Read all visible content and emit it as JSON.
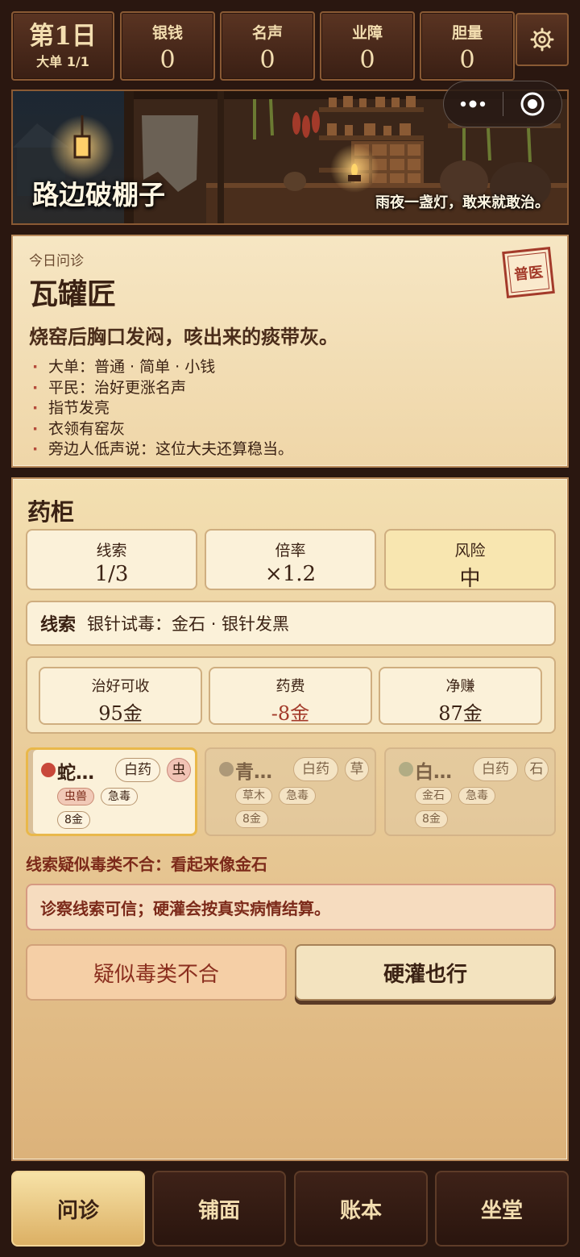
{
  "top_bar": {
    "day": {
      "label": "第1日",
      "sub": "大单 1/1"
    },
    "stats": [
      {
        "label": "银钱",
        "value": "0"
      },
      {
        "label": "名声",
        "value": "0"
      },
      {
        "label": "业障",
        "value": "0"
      },
      {
        "label": "胆量",
        "value": "0"
      }
    ],
    "settings_icon": "gear-icon"
  },
  "capsule": {
    "more_icon": "more-dots-icon",
    "close_icon": "target-close-icon"
  },
  "scene": {
    "title": "路边破棚子",
    "subtitle": "雨夜一盏灯，敢来就敢治。"
  },
  "patient": {
    "today_label": "今日问诊",
    "name": "瓦罐匠",
    "complaint": "烧窑后胸口发闷，咳出来的痰带灰。",
    "traits": [
      "大单：普通 · 简单 · 小钱",
      "平民：治好更涨名声",
      "指节发亮",
      "衣领有窑灰",
      "旁边人低声说：这位大夫还算稳当。"
    ],
    "stamp": "普医"
  },
  "cabinet": {
    "title": "药柜",
    "stats": [
      {
        "label": "线索",
        "value": "1/3"
      },
      {
        "label": "倍率",
        "value": "×1.2"
      },
      {
        "label": "风险",
        "value": "中"
      }
    ],
    "clue": {
      "label": "线索",
      "text": "银针试毒：金石 · 银针发黑"
    },
    "money": [
      {
        "label": "治好可收",
        "value": "95金"
      },
      {
        "label": "药费",
        "value": "-8金"
      },
      {
        "label": "净赚",
        "value": "87金"
      }
    ],
    "herbs": [
      {
        "name": "蛇…",
        "dot_color": "#c8483a",
        "type": "白药",
        "category": "虫",
        "tags": [
          "虫兽",
          "急毒"
        ],
        "cost": "8金",
        "selected": true
      },
      {
        "name": "青…",
        "dot_color": "#8a7a64",
        "type": "白药",
        "category": "草",
        "tags": [
          "草木",
          "急毒"
        ],
        "cost": "8金",
        "selected": false
      },
      {
        "name": "白…",
        "dot_color": "#8f9a78",
        "type": "白药",
        "category": "石",
        "tags": [
          "金石",
          "急毒"
        ],
        "cost": "8金",
        "selected": false
      }
    ],
    "warning": "线索疑似毒类不合：看起来像金石",
    "note": "诊察线索可信；硬灌会按真实病情结算。",
    "buttons": {
      "left": "疑似毒类不合",
      "right": "硬灌也行"
    }
  },
  "tabs": [
    {
      "label": "问诊",
      "active": true
    },
    {
      "label": "铺面",
      "active": false
    },
    {
      "label": "账本",
      "active": false
    },
    {
      "label": "坐堂",
      "active": false
    }
  ]
}
